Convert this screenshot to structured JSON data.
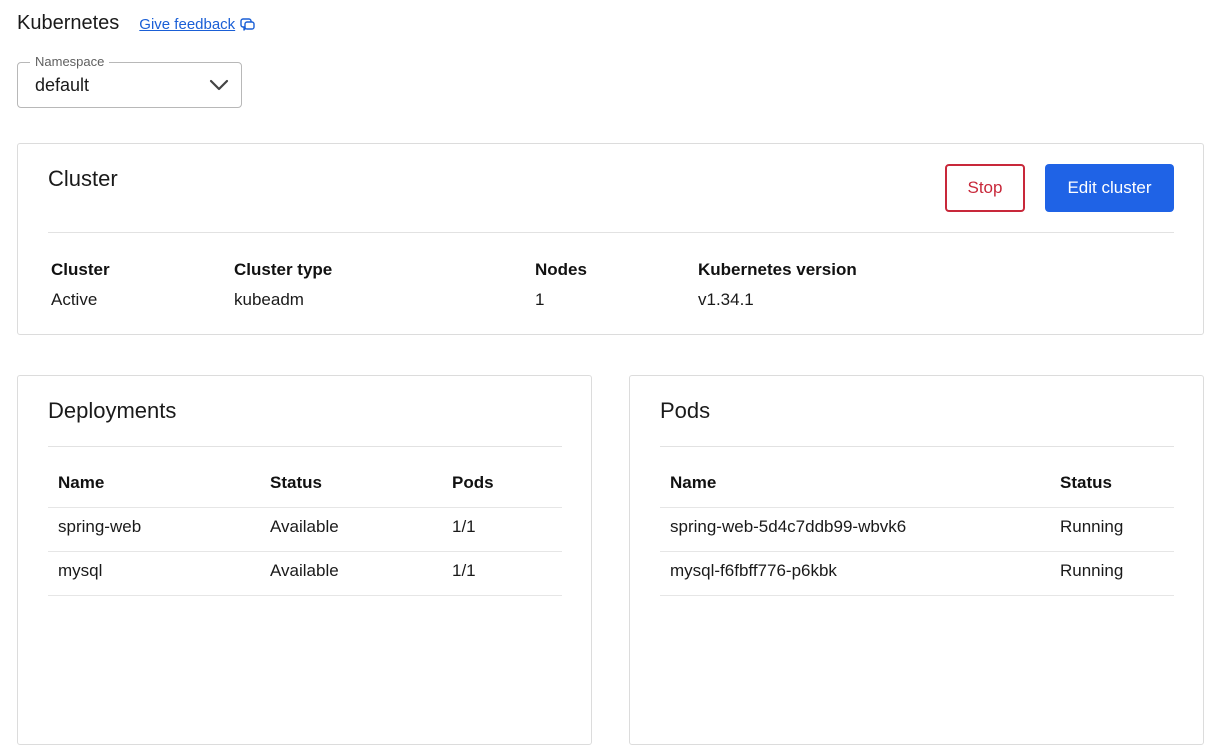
{
  "header": {
    "title": "Kubernetes",
    "feedback_label": "Give feedback"
  },
  "namespace": {
    "legend": "Namespace",
    "value": "default"
  },
  "cluster_card": {
    "title": "Cluster",
    "stop_label": "Stop",
    "edit_label": "Edit cluster",
    "info": [
      {
        "label": "Cluster",
        "value": "Active"
      },
      {
        "label": "Cluster type",
        "value": "kubeadm"
      },
      {
        "label": "Nodes",
        "value": "1"
      },
      {
        "label": "Kubernetes version",
        "value": "v1.34.1"
      }
    ]
  },
  "deployments": {
    "title": "Deployments",
    "columns": [
      "Name",
      "Status",
      "Pods"
    ],
    "rows": [
      [
        "spring-web",
        "Available",
        "1/1"
      ],
      [
        "mysql",
        "Available",
        "1/1"
      ]
    ]
  },
  "pods": {
    "title": "Pods",
    "columns": [
      "Name",
      "Status"
    ],
    "rows": [
      [
        "spring-web-5d4c7ddb99-wbvk6",
        "Running"
      ],
      [
        "mysql-f6fbff776-p6kbk",
        "Running"
      ]
    ]
  },
  "colors": {
    "primary": "#1f63e6",
    "danger": "#c8283a",
    "link": "#1a5fd6"
  },
  "icons": {
    "feedback": "chat-bubble-icon",
    "namespace_dropdown": "chevron-down-icon"
  }
}
